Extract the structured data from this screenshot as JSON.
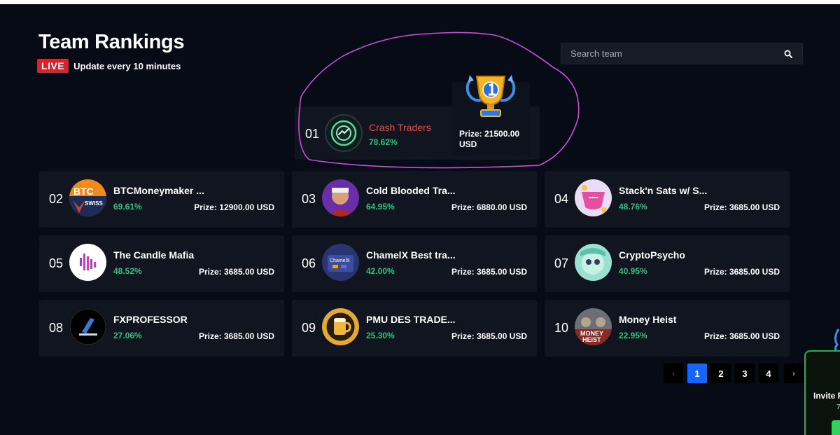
{
  "header": {
    "title": "Team Rankings",
    "live_badge": "LIVE",
    "update_text": "Update every 10 minutes"
  },
  "search": {
    "placeholder": "Search team"
  },
  "first_place": {
    "rank": "01",
    "name": "Crash Traders",
    "percent": "78.62%",
    "prize": "Prize: 21500.00 USD",
    "trophy_icon": "trophy-icon"
  },
  "teams": [
    {
      "rank": "02",
      "name": "BTCMoneymaker ...",
      "percent": "69.61%",
      "prize": "Prize: 12900.00 USD"
    },
    {
      "rank": "03",
      "name": "Cold Blooded Tra...",
      "percent": "64.95%",
      "prize": "Prize: 6880.00 USD"
    },
    {
      "rank": "04",
      "name": "Stack'n Sats w/ S...",
      "percent": "48.76%",
      "prize": "Prize: 3685.00 USD"
    },
    {
      "rank": "05",
      "name": "The Candle Mafia",
      "percent": "48.52%",
      "prize": "Prize: 3685.00 USD"
    },
    {
      "rank": "06",
      "name": "ChamelX Best tra...",
      "percent": "42.00%",
      "prize": "Prize: 3685.00 USD"
    },
    {
      "rank": "07",
      "name": "CryptoPsycho",
      "percent": "40.95%",
      "prize": "Prize: 3685.00 USD"
    },
    {
      "rank": "08",
      "name": "FXPROFESSOR",
      "percent": "27.06%",
      "prize": "Prize: 3685.00 USD"
    },
    {
      "rank": "09",
      "name": "PMU DES TRADE...",
      "percent": "25.30%",
      "prize": "Prize: 3685.00 USD"
    },
    {
      "rank": "10",
      "name": "Money Heist",
      "percent": "22.95%",
      "prize": "Prize: 3685.00 USD"
    }
  ],
  "pagination": {
    "prev": "‹",
    "pages": [
      "1",
      "2",
      "3",
      "4"
    ],
    "active_page": "1",
    "next": "›"
  },
  "invite_panel": {
    "text": "Invite F",
    "sub": "7"
  },
  "avatar_texts": {
    "btc_top": "BTC",
    "btc_bottom": "SWISS",
    "chamelx": "ChamelX",
    "money_heist": [
      "MONEY",
      "HEIST"
    ]
  },
  "colors": {
    "background": "#070b16",
    "card": "#10151f",
    "live_red": "#d8232a",
    "leader_name": "#f04a45",
    "percent_green": "#2ec27e",
    "active_page": "#1665ff",
    "annotation_magenta": "#c84fd8"
  }
}
